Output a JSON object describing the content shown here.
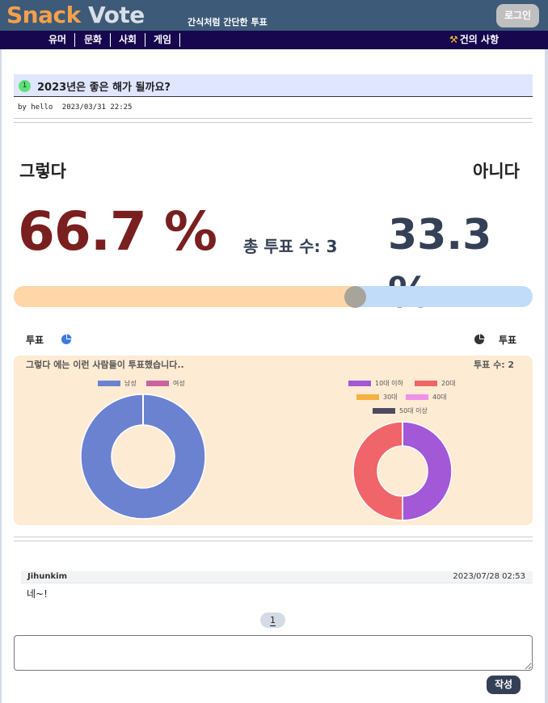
{
  "header": {
    "logo_snack": "Snack",
    "logo_vote": "Vote",
    "tagline": "간식처럼 간단한 투표",
    "login_label": "로그인"
  },
  "nav": {
    "items": [
      "유머",
      "문화",
      "사회",
      "게임"
    ],
    "suggestion": "건의 사항"
  },
  "post": {
    "number": "1",
    "title": "2023년은 좋은 해가 될까요?",
    "author": "by hello",
    "date": "2023/03/31 22:25"
  },
  "vote": {
    "option_left": "그렇다",
    "option_right": "아니다",
    "percent_left": "66.7 %",
    "percent_right": "33.3 %",
    "total_label": "총 투표 수: 3",
    "left_share": 0.667,
    "vote_label_left": "투표",
    "vote_label_right": "투표"
  },
  "stats": {
    "description": "그렇다 에는 이런 사람들이 투표했습니다..",
    "count_label": "투표 수: 2"
  },
  "chart_data": [
    {
      "type": "pie",
      "categories": [
        "남성",
        "여성"
      ],
      "values": [
        2,
        0
      ],
      "colors": [
        "#6a82d0",
        "#c8649e"
      ]
    },
    {
      "type": "pie",
      "categories": [
        "10대 이하",
        "20대",
        "30대",
        "40대",
        "50대 이상"
      ],
      "values": [
        1,
        1,
        0,
        0,
        0
      ],
      "colors": [
        "#a358d8",
        "#f0656a",
        "#f8b040",
        "#f090e8",
        "#4e4a60"
      ]
    }
  ],
  "comments": [
    {
      "author": "Jihunkim",
      "date": "2023/07/28 02:53",
      "text": "네~!"
    }
  ],
  "pagination": {
    "current": "1"
  },
  "form": {
    "submit_label": "작성"
  },
  "colors": {
    "header_bg": "#3d5a78",
    "nav_bg": "#16074f",
    "yes_color": "#7a1f1f",
    "no_color": "#344055",
    "bar_yes": "#fed6a8",
    "bar_no": "#c0dcf8",
    "stats_bg": "#feebd4"
  }
}
